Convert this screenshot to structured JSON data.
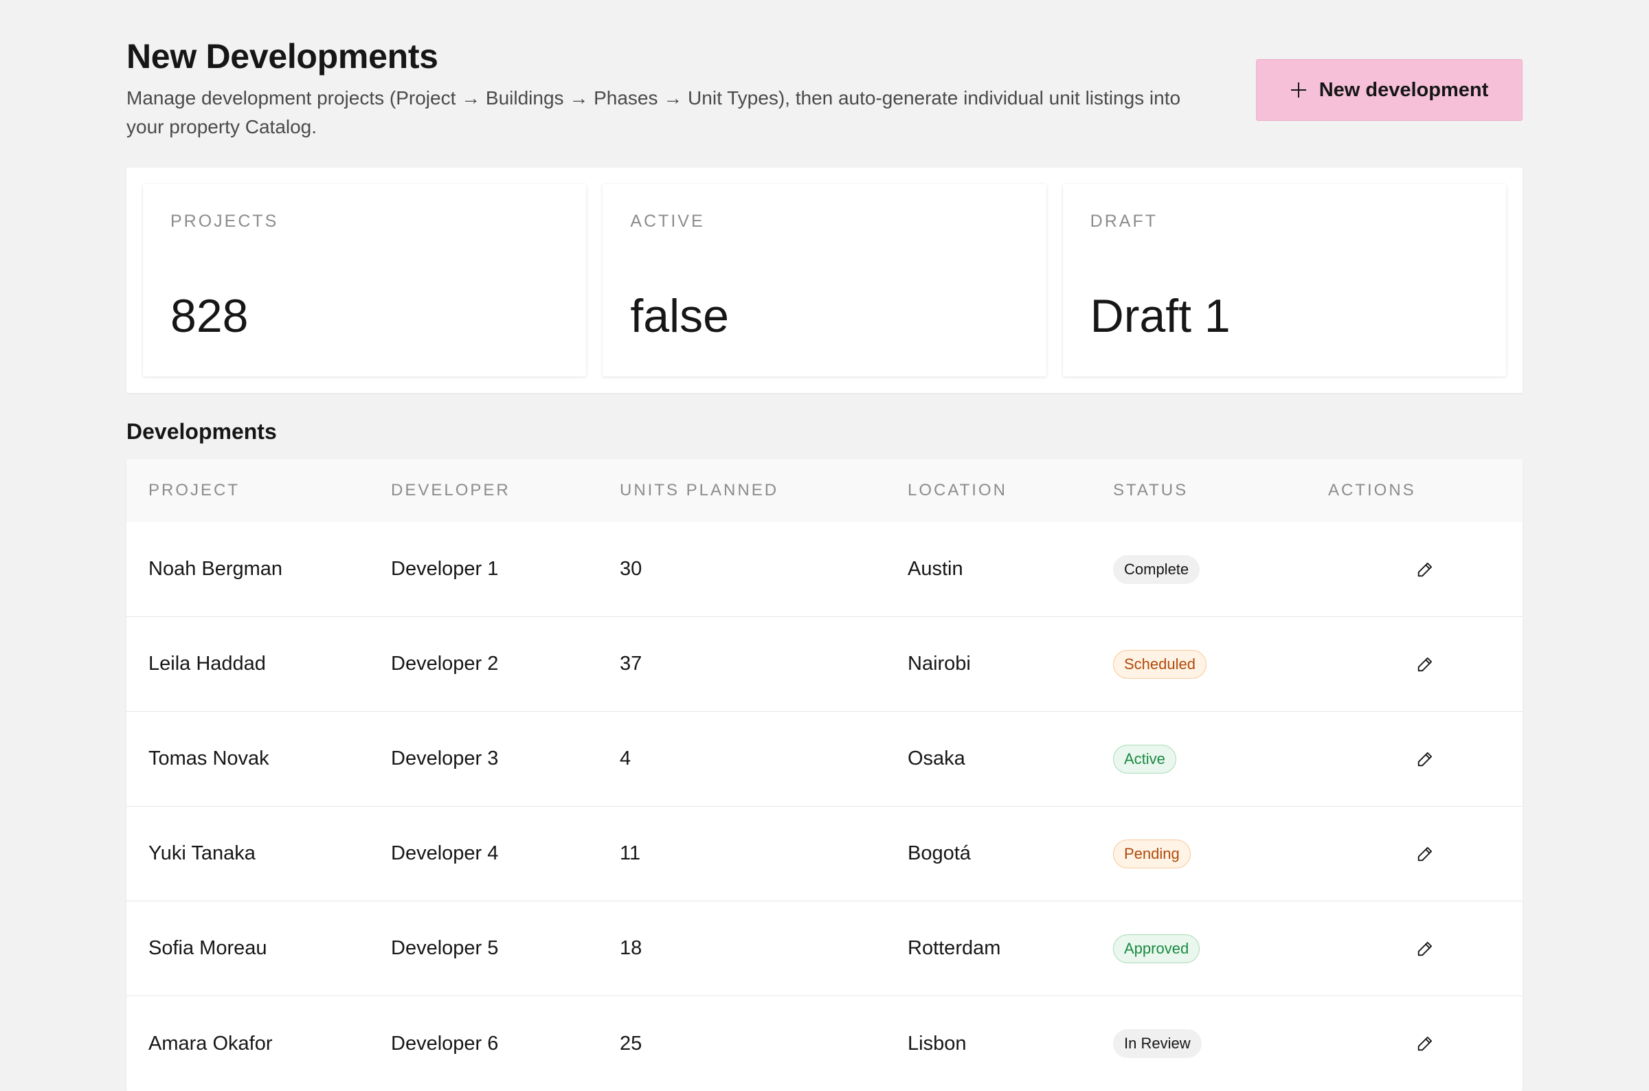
{
  "header": {
    "title": "New Developments",
    "subtitle": "Manage development projects (Project → Buildings → Phases → Unit Types), then auto-generate individual unit listings into your property Catalog.",
    "new_button_label": "New development",
    "new_button_icon": "plus-icon"
  },
  "stats": [
    {
      "label": "PROJECTS",
      "value": "828"
    },
    {
      "label": "ACTIVE",
      "value": "false"
    },
    {
      "label": "DRAFT",
      "value": "Draft 1"
    }
  ],
  "table": {
    "section_title": "Developments",
    "columns": [
      "PROJECT",
      "DEVELOPER",
      "UNITS PLANNED",
      "LOCATION",
      "STATUS",
      "ACTIONS"
    ],
    "rows": [
      {
        "project": "Noah Bergman",
        "developer": "Developer 1",
        "units": "30",
        "location": "Austin",
        "status": "Complete",
        "status_tone": "neutral"
      },
      {
        "project": "Leila Haddad",
        "developer": "Developer 2",
        "units": "37",
        "location": "Nairobi",
        "status": "Scheduled",
        "status_tone": "amber"
      },
      {
        "project": "Tomas Novak",
        "developer": "Developer 3",
        "units": "4",
        "location": "Osaka",
        "status": "Active",
        "status_tone": "green"
      },
      {
        "project": "Yuki Tanaka",
        "developer": "Developer 4",
        "units": "11",
        "location": "Bogotá",
        "status": "Pending",
        "status_tone": "amber"
      },
      {
        "project": "Sofia Moreau",
        "developer": "Developer 5",
        "units": "18",
        "location": "Rotterdam",
        "status": "Approved",
        "status_tone": "green"
      },
      {
        "project": "Amara Okafor",
        "developer": "Developer 6",
        "units": "25",
        "location": "Lisbon",
        "status": "In Review",
        "status_tone": "neutral"
      }
    ],
    "action_icon": "pencil-icon"
  },
  "colors": {
    "page_background": "#f2f2f2",
    "primary_button": "#f5c0d8",
    "status_green": "#1a8a42",
    "status_amber": "#b04a0a"
  }
}
